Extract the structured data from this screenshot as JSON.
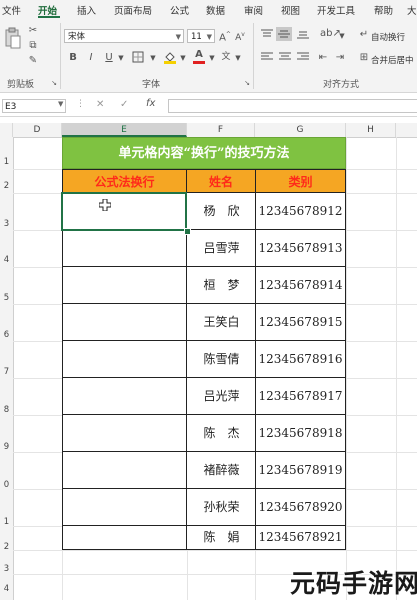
{
  "menu": {
    "items": [
      "文件",
      "开始",
      "插入",
      "页面布局",
      "公式",
      "数据",
      "审阅",
      "视图",
      "开发工具",
      "帮助"
    ],
    "active_index": 1,
    "overflow": "大"
  },
  "ribbon": {
    "font_name": "宋体",
    "font_size": "11",
    "bold": "B",
    "italic": "I",
    "underline": "U",
    "group_clipboard": "剪贴板",
    "group_font": "字体",
    "group_alignment": "对齐方式",
    "wrap_text": "自动换行",
    "merge_center": "合并后居中",
    "font_color_glyph": "A",
    "font_color": "#e02020",
    "highlight_color": "#f5d000"
  },
  "formula_bar": {
    "name_box": "E3",
    "cancel_glyph": "✕",
    "enter_glyph": "✓",
    "fx_glyph": "fx",
    "content": ""
  },
  "grid": {
    "columns": [
      "D",
      "E",
      "F",
      "G",
      "H"
    ],
    "selected_column": "E",
    "row_numbers": [
      "1",
      "2",
      "3",
      "4",
      "5",
      "6",
      "7",
      "8",
      "9",
      "0",
      "1",
      "2",
      "3",
      "4"
    ]
  },
  "table": {
    "title": "单元格内容“换行”的技巧方法",
    "headers": [
      "公式法换行",
      "姓名",
      "类别"
    ],
    "rows": [
      {
        "name": "杨　欣",
        "number": "12345678912"
      },
      {
        "name": "吕雪萍",
        "number": "12345678913"
      },
      {
        "name": "桓　梦",
        "number": "12345678914"
      },
      {
        "name": "王笑白",
        "number": "12345678915"
      },
      {
        "name": "陈雪倩",
        "number": "12345678916"
      },
      {
        "name": "吕光萍",
        "number": "12345678917"
      },
      {
        "name": "陈　杰",
        "number": "12345678918"
      },
      {
        "name": "褚醉薇",
        "number": "12345678919"
      },
      {
        "name": "孙秋荣",
        "number": "12345678920"
      },
      {
        "name": "陈　娟",
        "number": "12345678921"
      }
    ],
    "title_color": "#7fc241",
    "header_color": "#f5a623",
    "header_text_color": "#ff2a1a",
    "selection_color": "#217346"
  },
  "watermark": "元码手游网"
}
